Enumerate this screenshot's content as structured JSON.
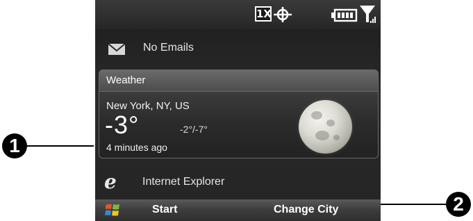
{
  "status_bar": {
    "network_label": "1X",
    "icons": [
      "data-1x-icon",
      "gps-crosshair-icon",
      "battery-icon",
      "signal-strength-icon"
    ]
  },
  "email": {
    "icon": "mail-icon",
    "label": "No Emails"
  },
  "weather": {
    "title": "Weather",
    "city": "New York, NY, US",
    "temperature": "-3°",
    "range": "-2°/-7°",
    "updated": "4 minutes ago",
    "condition_icon": "moon-icon"
  },
  "browser": {
    "icon": "internet-explorer-icon",
    "label": "Internet Explorer"
  },
  "softkeys": {
    "start_icon": "windows-start-icon",
    "left_label": "Start",
    "right_label": "Change City"
  },
  "callouts": {
    "one": "1",
    "two": "2"
  },
  "colors": {
    "screen_background": "#242424",
    "text": "#e6e6e6",
    "callout": "#000000"
  }
}
